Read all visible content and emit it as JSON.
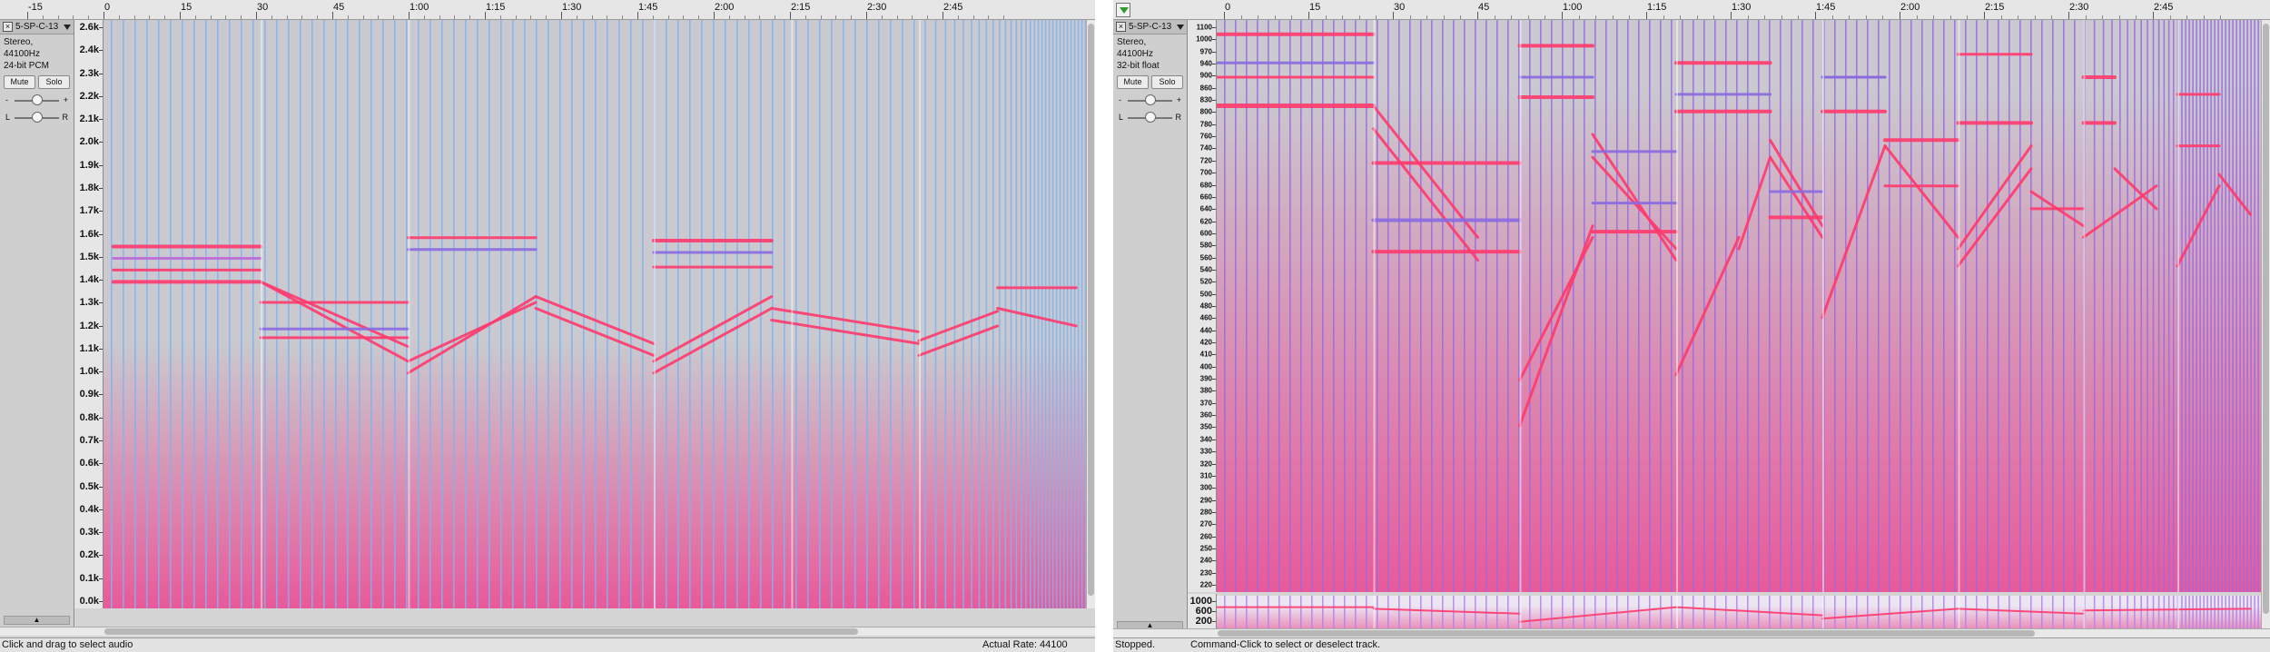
{
  "left": {
    "ruler": [
      "-15",
      "0",
      "15",
      "30",
      "45",
      "1:00",
      "1:15",
      "1:30",
      "1:45",
      "2:00",
      "2:15",
      "2:30",
      "2:45"
    ],
    "track": {
      "name": "5-SP-C-13",
      "info_line1": "Stereo, 44100Hz",
      "info_line2": "24-bit PCM",
      "mute_label": "Mute",
      "solo_label": "Solo",
      "gain_minus": "-",
      "gain_plus": "+",
      "pan_left": "L",
      "pan_right": "R"
    },
    "freq_axis": [
      "2.6k",
      "2.4k",
      "2.3k",
      "2.2k",
      "2.1k",
      "2.0k",
      "1.9k",
      "1.8k",
      "1.7k",
      "1.6k",
      "1.5k",
      "1.4k",
      "1.3k",
      "1.2k",
      "1.1k",
      "1.0k",
      "0.9k",
      "0.8k",
      "0.7k",
      "0.6k",
      "0.5k",
      "0.4k",
      "0.3k",
      "0.2k",
      "0.1k",
      "0.0k"
    ],
    "status_left": "Click and drag to select audio",
    "status_right": "Actual Rate: 44100"
  },
  "right": {
    "ruler": [
      "0",
      "15",
      "30",
      "45",
      "1:00",
      "1:15",
      "1:30",
      "1:45",
      "2:00",
      "2:15",
      "2:30",
      "2:45"
    ],
    "track": {
      "name": "5-SP-C-13",
      "info_line1": "Stereo, 44100Hz",
      "info_line2": "32-bit float",
      "mute_label": "Mute",
      "solo_label": "Solo",
      "gain_minus": "-",
      "gain_plus": "+",
      "pan_left": "L",
      "pan_right": "R"
    },
    "freq_axis": [
      "1100",
      "1000",
      "970",
      "940",
      "900",
      "860",
      "830",
      "800",
      "780",
      "760",
      "740",
      "720",
      "700",
      "680",
      "660",
      "640",
      "620",
      "600",
      "580",
      "560",
      "540",
      "520",
      "500",
      "480",
      "460",
      "440",
      "420",
      "410",
      "400",
      "390",
      "380",
      "370",
      "360",
      "350",
      "340",
      "330",
      "320",
      "310",
      "300",
      "290",
      "280",
      "270",
      "260",
      "250",
      "240",
      "230",
      "220"
    ],
    "freq_axis_lower": [
      "1000",
      "600",
      "200"
    ],
    "status_left": "Stopped.",
    "status_center": "Command-Click to select or deselect track."
  }
}
